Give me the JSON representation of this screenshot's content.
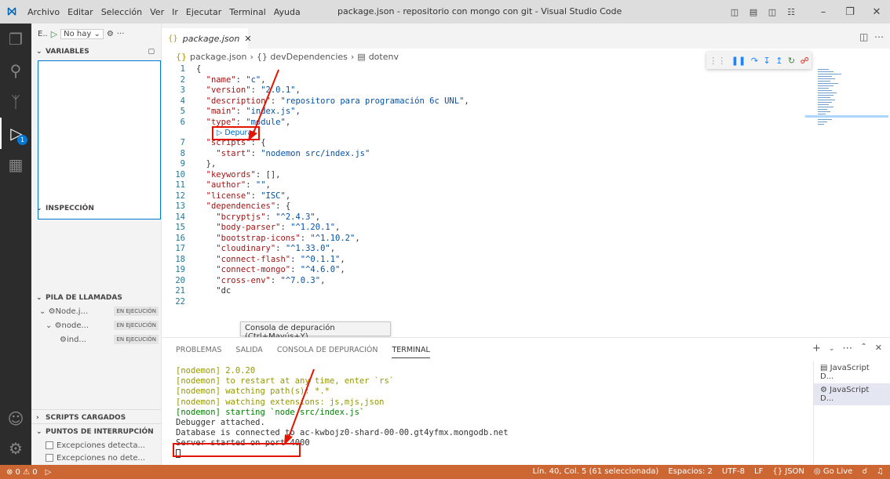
{
  "titlebar": {
    "menu": [
      "Archivo",
      "Editar",
      "Selección",
      "Ver",
      "Ir",
      "Ejecutar",
      "Terminal",
      "Ayuda"
    ],
    "window_title": "package.json - repositorio con mongo con git - Visual Studio Code",
    "controls": [
      "minimize-icon",
      "maximize-icon",
      "close-icon"
    ]
  },
  "activity_bar": {
    "items": [
      "explorer-icon",
      "search-icon",
      "source-control-icon",
      "run-debug-icon",
      "extensions-icon"
    ],
    "debug_badge": "1",
    "bottom": [
      "account-icon",
      "manage-icon"
    ]
  },
  "sidebar": {
    "toolbar": {
      "short": "E..",
      "config": "No hay",
      "more": "···"
    },
    "variables": "VARIABLES",
    "inspeccion": "INSPECCIÓN",
    "pila": "PILA DE LLAMADAS",
    "stack": [
      {
        "label": "Node.j...",
        "status": "EN EJECUCIÓN"
      },
      {
        "label": "node...",
        "status": "EN EJECUCIÓN"
      },
      {
        "label": "ind...",
        "status": "EN EJECUCIÓN"
      }
    ],
    "scripts": "SCRIPTS CARGADOS",
    "puntos": "PUNTOS DE INTERRUPCIÓN",
    "breakpoints": [
      "Excepciones detecta...",
      "Excepciones no dete..."
    ]
  },
  "editor": {
    "tab": "package.json",
    "breadcrumb": [
      "package.json",
      "{} devDependencies",
      "dotenv"
    ],
    "codelens": "▷ Depurar",
    "tooltip": "Consola de depuración (Ctrl+Mayús+Y)"
  },
  "code_lines": [
    {
      "n": "1",
      "t": "{"
    },
    {
      "n": "2",
      "t": "  \"name\": \"c\","
    },
    {
      "n": "3",
      "t": "  \"version\": \"2.0.1\","
    },
    {
      "n": "4",
      "t": "  \"description\": \"repositoro para programación 6c UNL\","
    },
    {
      "n": "5",
      "t": "  \"main\": \"index.js\","
    },
    {
      "n": "6",
      "t": "  \"type\": \"module\","
    },
    {
      "n": "7",
      "t": "  \"scripts\": {"
    },
    {
      "n": "8",
      "t": "    \"start\": \"nodemon src/index.js\""
    },
    {
      "n": "9",
      "t": "  },"
    },
    {
      "n": "10",
      "t": "  \"keywords\": [],"
    },
    {
      "n": "11",
      "t": "  \"author\": \"\","
    },
    {
      "n": "12",
      "t": "  \"license\": \"ISC\","
    },
    {
      "n": "13",
      "t": "  \"dependencies\": {"
    },
    {
      "n": "14",
      "t": "    \"bcryptjs\": \"^2.4.3\","
    },
    {
      "n": "15",
      "t": "    \"body-parser\": \"^1.20.1\","
    },
    {
      "n": "16",
      "t": "    \"bootstrap-icons\": \"^1.10.2\","
    },
    {
      "n": "17",
      "t": "    \"cloudinary\": \"^1.33.0\","
    },
    {
      "n": "18",
      "t": "    \"connect-flash\": \"^0.1.1\","
    },
    {
      "n": "19",
      "t": "    \"connect-mongo\": \"^4.6.0\","
    },
    {
      "n": "20",
      "t": "    \"cross-env\": \"^7.0.3\","
    },
    {
      "n": "21",
      "t": "    \"dc"
    },
    {
      "n": "22",
      "t": ""
    }
  ],
  "panel": {
    "tabs": [
      "PROBLEMAS",
      "SALIDA",
      "CONSOLA DE DEPURACIÓN",
      "TERMINAL"
    ],
    "active_tab": "TERMINAL",
    "terminal_lines": [
      "[nodemon] 2.0.20",
      "[nodemon] to restart at any time, enter `rs`",
      "[nodemon] watching path(s): *.*",
      "[nodemon] watching extensions: js,mjs,json",
      "[nodemon] starting `node src/index.js`",
      "Debugger attached.",
      "Database is connected to ac-kwbojz0-shard-00-00.gt4yfmx.mongodb.net",
      "Server started on port 4000"
    ],
    "terminals": [
      "JavaScript D...",
      "JavaScript D..."
    ]
  },
  "statusbar": {
    "left": "⊗ 0 ⚠ 0",
    "right": [
      "Lín. 40, Col. 5 (61 seleccionada)",
      "Espacios: 2",
      "UTF-8",
      "LF",
      "{} JSON",
      "Go Live"
    ]
  },
  "colors": {
    "statusbar": "#cc6633",
    "highlight": "#e51400",
    "accent": "#0078d4"
  }
}
